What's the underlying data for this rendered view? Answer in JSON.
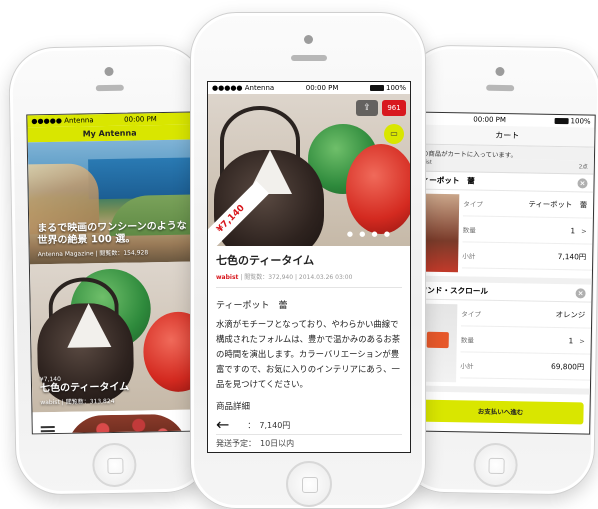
{
  "left_app": {
    "status": {
      "carrier": "●●●●● Antenna",
      "time": "00:00 PM"
    },
    "header_title": "My Antenna",
    "tiles": [
      {
        "title": "まるで映画のワンシーンのような世界の絶景 100 選。",
        "meta": "Antenna Magazine | 閲覧数：154,928"
      },
      {
        "title": "七色のティータイム",
        "price": "¥7,140",
        "meta": "wabist | 閲覧数：313,824"
      }
    ]
  },
  "mid_app": {
    "status": {
      "carrier": "●●●●● Antenna",
      "time": "00:00 PM",
      "battery": "100%"
    },
    "badge_count": "961",
    "price_ribbon": "¥7,140",
    "dots": "● ● ● ●",
    "title": "七色のティータイム",
    "meta_source": "wabist",
    "meta_rest": "| 閲覧数：372,940 | 2014.03.26  03:00",
    "subtitle": "ティーポット　蕾",
    "description": "水滴がモチーフとなっており、やわらかい曲線で構成されたフォルムは、豊かで温かみのあるお茶の時間を演出します。カラーバリエーションが豊富ですので、お気に入りのインテリアにあう、一品を見つけてください。",
    "details_heading": "商品詳細",
    "price_line": "：　7,140円",
    "shipping_line": "発送予定：　10日以内"
  },
  "right_app": {
    "status": {
      "time": "00:00 PM",
      "battery": "100%"
    },
    "header_title": "カート",
    "note": "の商品がカートに入っています。",
    "shop": "bist",
    "count": "2点",
    "items": [
      {
        "title": "ィーポット　蕾",
        "rows": [
          {
            "label": "タイプ",
            "value": "ティーポット　蕾"
          },
          {
            "label": "数量",
            "value": "1"
          },
          {
            "label": "小計",
            "value": "7,140円"
          }
        ]
      },
      {
        "title": "ワンド・スクロール",
        "rows": [
          {
            "label": "タイプ",
            "value": "オレンジ"
          },
          {
            "label": "数量",
            "value": "1"
          },
          {
            "label": "小計",
            "value": "69,800円"
          }
        ]
      }
    ],
    "pay_button": "お支払いへ進む"
  }
}
